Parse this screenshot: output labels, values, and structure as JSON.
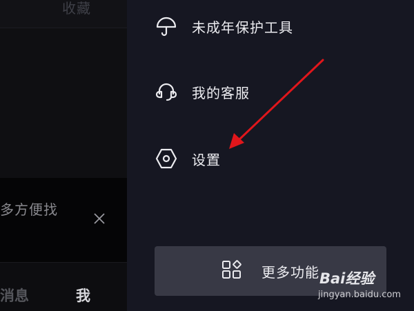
{
  "left_panel": {
    "top_label": "收藏",
    "banner_text": "多方便找",
    "tabs": {
      "messages": "消息",
      "me": "我"
    }
  },
  "drawer": {
    "items": [
      {
        "label": "未成年保护工具",
        "icon": "umbrella-icon"
      },
      {
        "label": "我的客服",
        "icon": "headset-icon"
      },
      {
        "label": "设置",
        "icon": "hexagon-settings-icon"
      }
    ],
    "more_button": {
      "label": "更多功能",
      "icon": "grid-apps-icon"
    }
  },
  "watermark": {
    "brand": "Bai经验",
    "url": "jingyan.baidu.com"
  },
  "colors": {
    "drawer_bg": "#161722",
    "button_bg": "#383945",
    "arrow": "#e0161b"
  }
}
